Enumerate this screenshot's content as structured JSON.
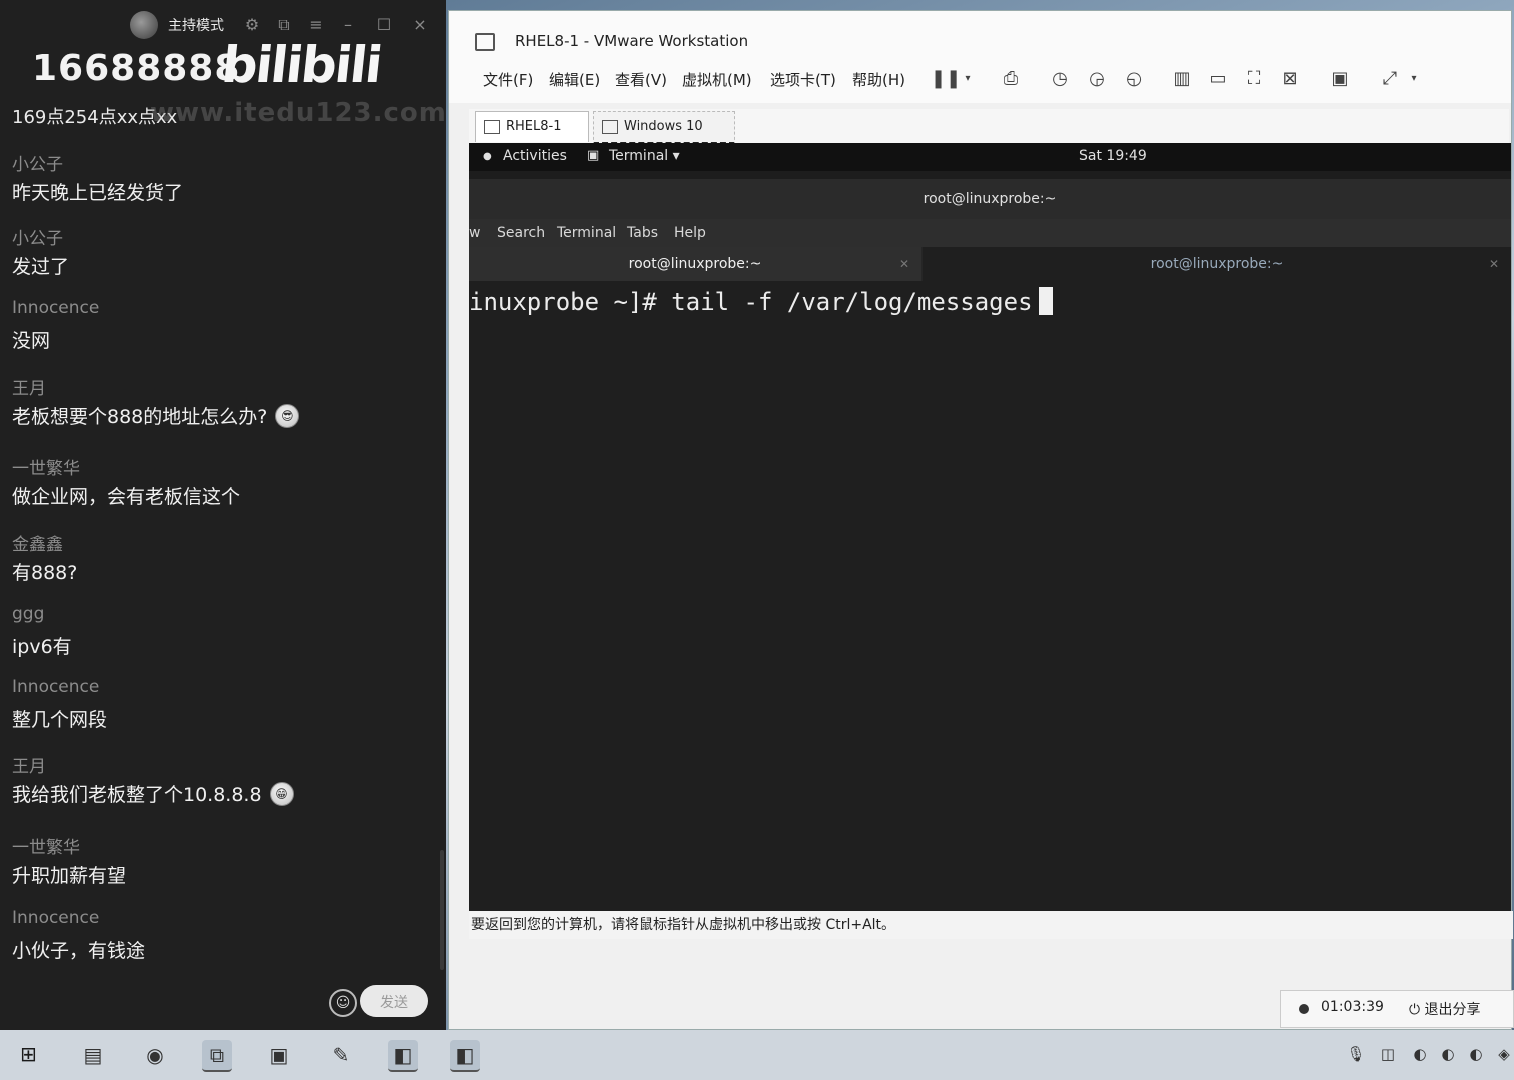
{
  "chat": {
    "host_mode": "主持模式",
    "room_number": "16688888",
    "logo": "bilibili",
    "info": "169点254点xx点xx",
    "watermark": "www.itedu123.com",
    "send_label": "发送",
    "messages": [
      {
        "user": "小公子",
        "text": "昨天晚上已经发货了"
      },
      {
        "user": "小公子",
        "text": "发过了"
      },
      {
        "user": "Innocence",
        "text": "没网"
      },
      {
        "user": "王月",
        "text": "老板想要个888的地址怎么办?"
      },
      {
        "user": "一世繁华",
        "text": "做企业网，会有老板信这个"
      },
      {
        "user": "金鑫鑫",
        "text": "有888?"
      },
      {
        "user": "ggg",
        "text": "ipv6有"
      },
      {
        "user": "Innocence",
        "text": "整几个网段"
      },
      {
        "user": "王月",
        "text": "我给我们老板整了个10.8.8.8"
      },
      {
        "user": "一世繁华",
        "text": "升职加薪有望"
      },
      {
        "user": "Innocence",
        "text": "小伙子，有钱途"
      }
    ]
  },
  "vmware": {
    "title": "RHEL8-1 - VMware Workstation",
    "menu": [
      "文件(F)",
      "编辑(E)",
      "查看(V)",
      "虚拟机(M)",
      "选项卡(T)",
      "帮助(H)"
    ],
    "tabs": [
      "RHEL8-1",
      "Windows 10"
    ],
    "status_hint": "要返回到您的计算机，请将鼠标指针从虚拟机中移出或按 Ctrl+Alt。"
  },
  "guest": {
    "activities": "Activities",
    "app_menu": "Terminal ▾",
    "clock": "Sat 19:49",
    "window_title": "root@linuxprobe:~",
    "terminal_menu": [
      "w",
      "Search",
      "Terminal",
      "Tabs",
      "Help"
    ],
    "terminal_tabs": [
      "root@linuxprobe:~",
      "root@linuxprobe:~"
    ],
    "command_line": "inuxprobe ~]# tail -f /var/log/messages"
  },
  "share": {
    "elapsed": "01:03:39",
    "exit_label": "退出分享"
  }
}
